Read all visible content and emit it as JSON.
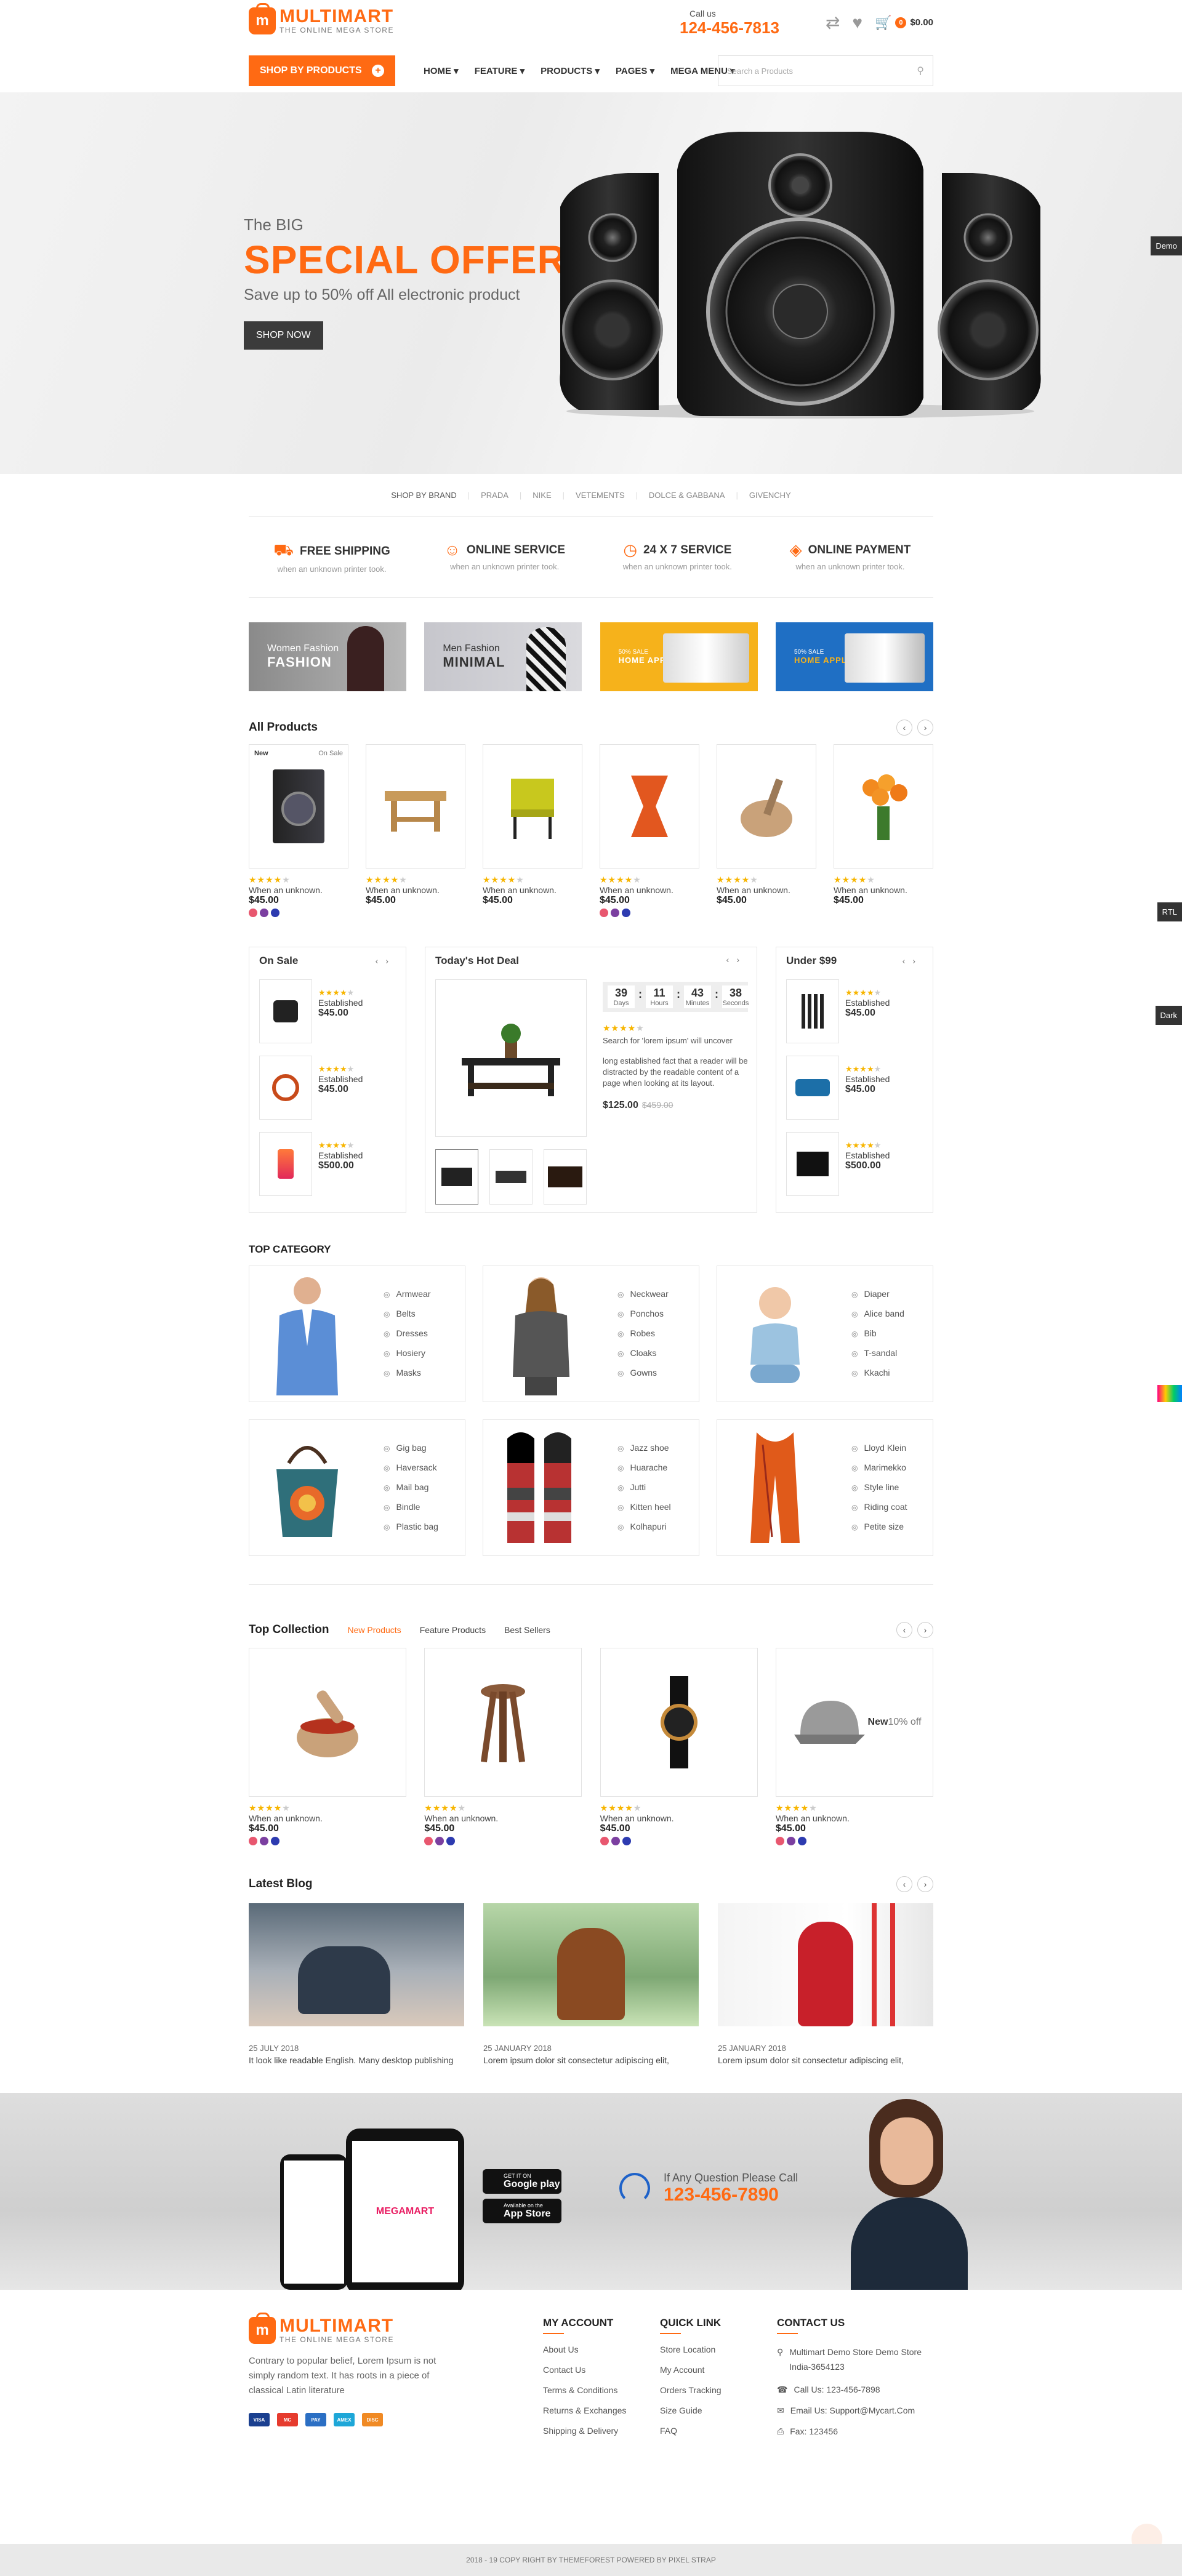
{
  "header": {
    "logo_text": "MULTIMART",
    "logo_sub": "THE ONLINE MEGA STORE",
    "call_label": "Call us",
    "phone": "124-456-7813",
    "cart_count": "0",
    "cart_total": "$0.00"
  },
  "nav": {
    "shop_by_products": "SHOP BY PRODUCTS",
    "menu": [
      "HOME",
      "FEATURE",
      "PRODUCTS",
      "PAGES",
      "MEGA MENU"
    ],
    "search_placeholder": "Search a Products"
  },
  "hero": {
    "eyebrow": "The BIG",
    "headline": "SPECIAL OFFER",
    "sub": "Save up to 50% off All electronic product",
    "button": "SHOP NOW"
  },
  "side_tabs": {
    "demo": "Demo",
    "rtl": "RTL",
    "dark": "Dark"
  },
  "brands": {
    "label": "SHOP BY BRAND",
    "items": [
      "PRADA",
      "NIKE",
      "VETEMENTS",
      "DOLCE & GABBANA",
      "GIVENCHY"
    ]
  },
  "services": [
    {
      "title": "FREE SHIPPING",
      "desc": "when an unknown printer took.",
      "icon": "truck-icon"
    },
    {
      "title": "ONLINE SERVICE",
      "desc": "when an unknown printer took.",
      "icon": "support-icon"
    },
    {
      "title": "24 X 7 SERVICE",
      "desc": "when an unknown printer took.",
      "icon": "clock-icon"
    },
    {
      "title": "ONLINE PAYMENT",
      "desc": "when an unknown printer took.",
      "icon": "payment-icon"
    }
  ],
  "banners": [
    {
      "line1": "Women Fashion",
      "line2": "FASHION"
    },
    {
      "line1": "Men Fashion",
      "line2": "MINIMAL"
    },
    {
      "line1": "50% SALE",
      "line2": "HOME APPLIENCE"
    },
    {
      "line1": "50% SALE",
      "line2": "HOME APPLIENCE"
    }
  ],
  "all_products": {
    "title": "All Products",
    "items": [
      {
        "tag_left": "New",
        "tag_right": "On Sale",
        "text": "When an unknown.",
        "price": "$45.00",
        "swatches": true
      },
      {
        "tag_left": "",
        "tag_right": "",
        "text": "When an unknown.",
        "price": "$45.00",
        "swatches": false
      },
      {
        "tag_left": "",
        "tag_right": "",
        "text": "When an unknown.",
        "price": "$45.00",
        "swatches": false
      },
      {
        "tag_left": "",
        "tag_right": "",
        "text": "When an unknown.",
        "price": "$45.00",
        "swatches": true
      },
      {
        "tag_left": "",
        "tag_right": "",
        "text": "When an unknown.",
        "price": "$45.00",
        "swatches": false
      },
      {
        "tag_left": "",
        "tag_right": "",
        "text": "When an unknown.",
        "price": "$45.00",
        "swatches": false
      }
    ]
  },
  "on_sale": {
    "title": "On Sale",
    "items": [
      {
        "name": "Established",
        "price": "$45.00"
      },
      {
        "name": "Established",
        "price": "$45.00"
      },
      {
        "name": "Established",
        "price": "$500.00"
      }
    ]
  },
  "hot_deal": {
    "title": "Today's Hot Deal",
    "timer": {
      "days": "39",
      "hours": "11",
      "minutes": "43",
      "seconds": "38",
      "days_label": "Days",
      "hours_label": "Hours",
      "minutes_label": "Minutes",
      "seconds_label": "Seconds"
    },
    "title_text": "Search for 'lorem ipsum' will uncover",
    "desc": "long established fact that a reader will be distracted by the readable content of a page when looking at its layout.",
    "price": "$125.00",
    "old_price": "$459.00"
  },
  "under99": {
    "title": "Under $99",
    "items": [
      {
        "name": "Established",
        "price": "$45.00"
      },
      {
        "name": "Established",
        "price": "$45.00"
      },
      {
        "name": "Established",
        "price": "$500.00"
      }
    ]
  },
  "top_category": {
    "title": "TOP CATEGORY",
    "cats": [
      {
        "items": [
          "Armwear",
          "Belts",
          "Dresses",
          "Hosiery",
          "Masks"
        ]
      },
      {
        "items": [
          "Neckwear",
          "Ponchos",
          "Robes",
          "Cloaks",
          "Gowns"
        ]
      },
      {
        "items": [
          "Diaper",
          "Alice band",
          "Bib",
          "T-sandal",
          "Kkachi"
        ]
      },
      {
        "items": [
          "Gig bag",
          "Haversack",
          "Mail bag",
          "Bindle",
          "Plastic bag"
        ]
      },
      {
        "items": [
          "Jazz shoe",
          "Huarache",
          "Jutti",
          "Kitten heel",
          "Kolhapuri"
        ]
      },
      {
        "items": [
          "Lloyd Klein",
          "Marimekko",
          "Style line",
          "Riding coat",
          "Petite size"
        ]
      }
    ]
  },
  "top_collection": {
    "title": "Top Collection",
    "tabs": [
      "New Products",
      "Feature Products",
      "Best Sellers"
    ],
    "items": [
      {
        "tag_left": "",
        "tag_right": "",
        "text": "When an unknown.",
        "price": "$45.00"
      },
      {
        "tag_left": "",
        "tag_right": "",
        "text": "When an unknown.",
        "price": "$45.00"
      },
      {
        "tag_left": "",
        "tag_right": "",
        "text": "When an unknown.",
        "price": "$45.00"
      },
      {
        "tag_left": "New",
        "tag_right": "10% off",
        "text": "When an unknown.",
        "price": "$45.00"
      }
    ]
  },
  "latest_blog": {
    "title": "Latest Blog",
    "posts": [
      {
        "date": "25 JULY 2018",
        "title": "It look like readable English. Many desktop publishing"
      },
      {
        "date": "25 JANUARY 2018",
        "title": "Lorem ipsum dolor sit consectetur adipiscing elit,"
      },
      {
        "date": "25 JANUARY 2018",
        "title": "Lorem ipsum dolor sit consectetur adipiscing elit,"
      }
    ]
  },
  "app_banner": {
    "google_small": "GET IT ON",
    "google": "Google play",
    "apple_small": "Available on the",
    "apple": "App Store",
    "question": "If Any Question Please Call",
    "phone": "123-456-7890",
    "phone_logo": "MEGAMART"
  },
  "footer": {
    "about": "Contrary to popular belief, Lorem Ipsum is not simply random text. It has roots in a piece of classical Latin literature",
    "my_account_title": "MY ACCOUNT",
    "my_account": [
      "About Us",
      "Contact Us",
      "Terms & Conditions",
      "Returns & Exchanges",
      "Shipping & Delivery"
    ],
    "quick_link_title": "QUICK LINK",
    "quick_link": [
      "Store Location",
      "My Account",
      "Orders Tracking",
      "Size Guide",
      "FAQ"
    ],
    "contact_title": "CONTACT US",
    "contact": [
      "Multimart Demo Store Demo Store India-3654123",
      "Call Us: 123-456-7898",
      "Email Us: Support@Mycart.Com",
      "Fax: 123456"
    ],
    "cards": [
      "VISA",
      "MC",
      "PAY",
      "AMEX",
      "DISC"
    ],
    "copyright": "2018 - 19 COPY RIGHT BY THEMEFOREST POWERED BY PIXEL STRAP"
  },
  "colors": {
    "accent": "#ff6a13",
    "dark": "#3b3b3b"
  }
}
